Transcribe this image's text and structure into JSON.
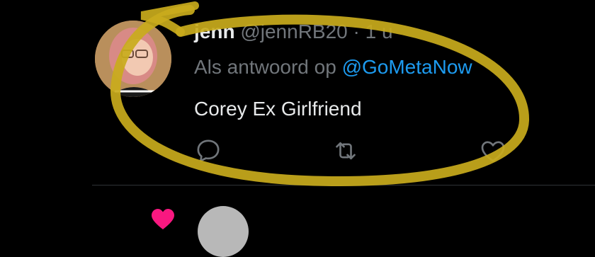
{
  "tweet": {
    "display_name": "jenn",
    "handle": "@jennRB20",
    "separator": "·",
    "time": "1 u",
    "reply_prefix": "Als antwoord op ",
    "reply_mention": "@GoMetaNow",
    "text": "Corey Ex Girlfriend"
  },
  "actions": {
    "reply_icon": "reply-icon",
    "retweet_icon": "retweet-icon",
    "like_icon": "heart-icon"
  },
  "colors": {
    "background": "#000000",
    "text_primary": "#e7e9ea",
    "text_secondary": "#71767b",
    "link": "#1d9bf0",
    "highlight_annotation": "#c9ab1c",
    "next_like": "#f91880"
  }
}
